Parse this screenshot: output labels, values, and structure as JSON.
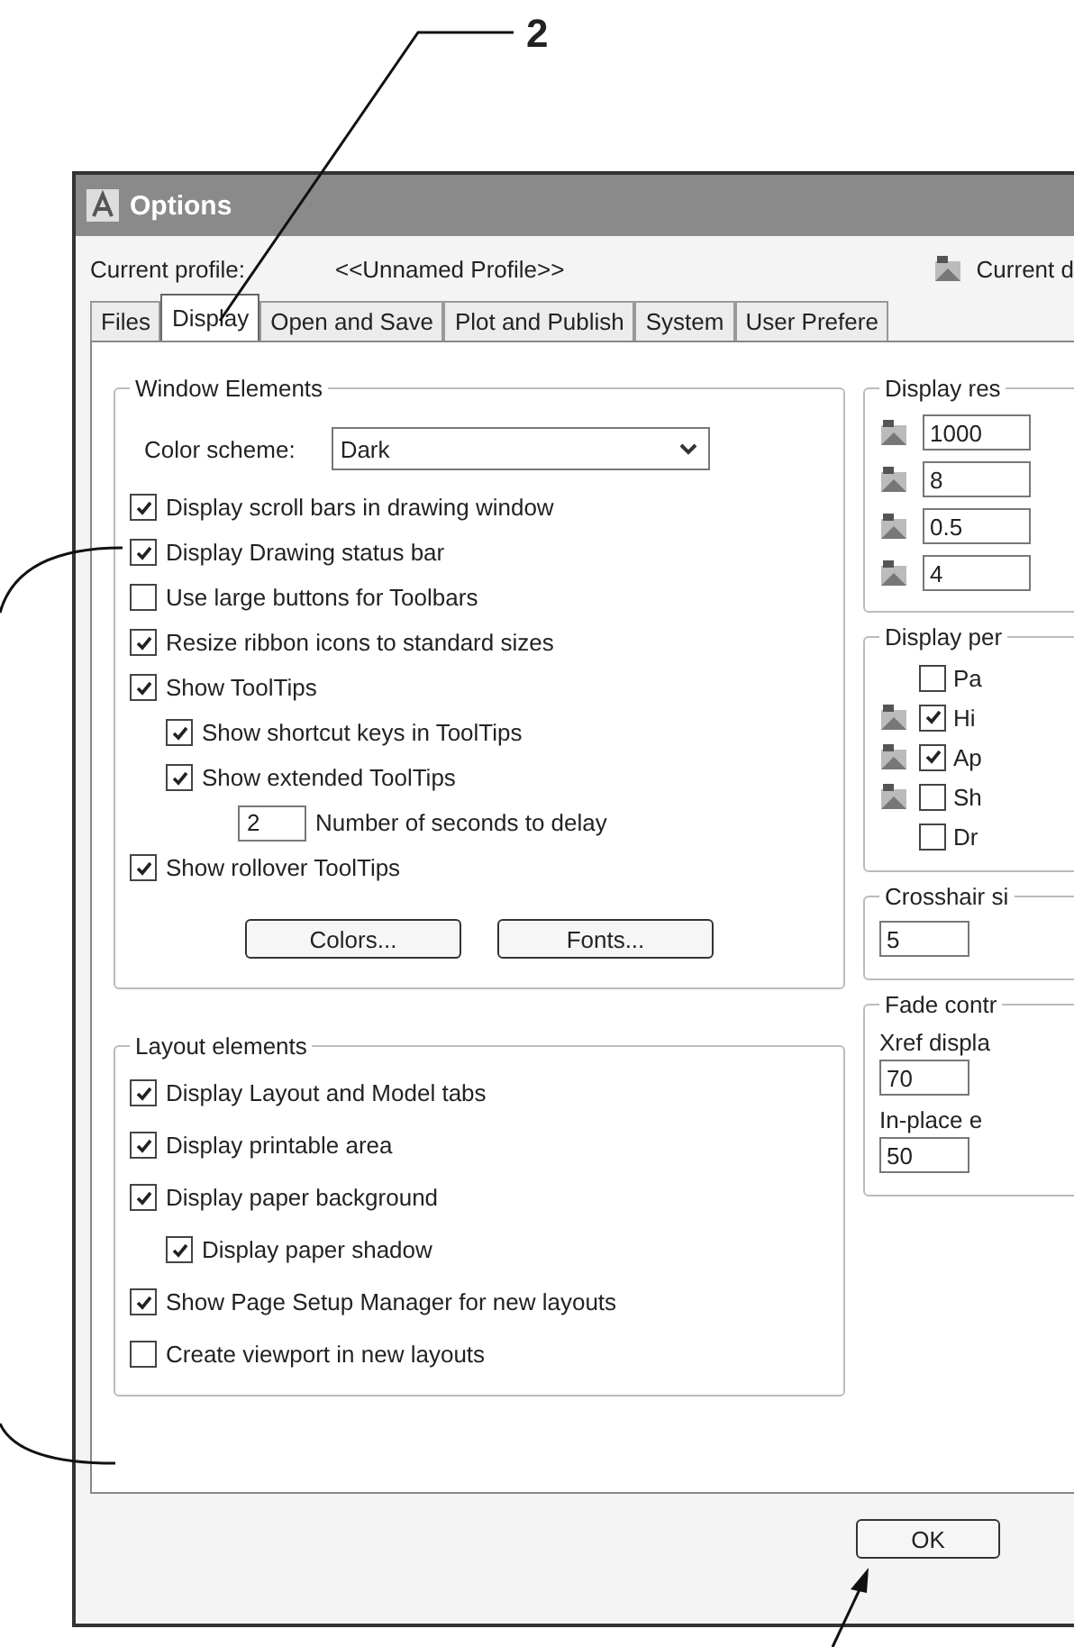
{
  "callout": {
    "label": "2"
  },
  "window": {
    "title": "Options"
  },
  "profile": {
    "label": "Current profile:",
    "value": "<<Unnamed Profile>>",
    "current": "Current d"
  },
  "tabs": [
    {
      "label": "Files",
      "selected": false
    },
    {
      "label": "Display",
      "selected": true
    },
    {
      "label": "Open and Save",
      "selected": false
    },
    {
      "label": "Plot and Publish",
      "selected": false
    },
    {
      "label": "System",
      "selected": false
    },
    {
      "label": "User Prefere",
      "selected": false
    }
  ],
  "window_elements": {
    "title": "Window Elements",
    "color_scheme": {
      "label": "Color scheme:",
      "value": "Dark"
    },
    "options": [
      {
        "kind": "checkbox",
        "label": "Display scroll bars in drawing window",
        "checked": true
      },
      {
        "kind": "checkbox",
        "label": "Display Drawing status bar",
        "checked": true
      },
      {
        "kind": "checkbox",
        "label": "Use large buttons for Toolbars",
        "checked": false
      },
      {
        "kind": "checkbox",
        "label": "Resize ribbon icons to standard sizes",
        "checked": true
      },
      {
        "kind": "checkbox",
        "label": "Show ToolTips",
        "checked": true,
        "children": [
          {
            "kind": "checkbox",
            "label": "Show shortcut keys in ToolTips",
            "checked": true
          },
          {
            "kind": "checkbox",
            "label": "Show extended ToolTips",
            "checked": true,
            "children": [
              {
                "kind": "number",
                "value": "2",
                "label": "Number of seconds to delay"
              }
            ]
          }
        ]
      },
      {
        "kind": "checkbox",
        "label": "Show rollover ToolTips",
        "checked": true
      }
    ],
    "buttons": [
      "Colors...",
      "Fonts..."
    ]
  },
  "layout_elements": {
    "title": "Layout elements",
    "options": [
      {
        "kind": "checkbox",
        "label": "Display Layout and Model tabs",
        "checked": true
      },
      {
        "kind": "checkbox",
        "label": "Display printable area",
        "checked": true
      },
      {
        "kind": "checkbox",
        "label": "Display paper background",
        "checked": true,
        "children": [
          {
            "kind": "checkbox",
            "label": "Display paper shadow",
            "checked": true
          }
        ]
      },
      {
        "kind": "checkbox",
        "label": "Show Page Setup Manager for new layouts",
        "checked": true
      },
      {
        "kind": "checkbox",
        "label": "Create viewport in new layouts",
        "checked": false
      }
    ]
  },
  "display_resolution": {
    "title": "Display res",
    "values": [
      "1000",
      "8",
      "0.5",
      "4"
    ]
  },
  "display_performance": {
    "title": "Display per",
    "options": [
      {
        "label": "Pa",
        "checked": false,
        "icon": false
      },
      {
        "label": "Hi",
        "checked": true,
        "icon": true
      },
      {
        "label": "Ap",
        "checked": true,
        "icon": true
      },
      {
        "label": "Sh",
        "checked": false,
        "icon": true
      },
      {
        "label": "Dr",
        "checked": false,
        "icon": false
      }
    ]
  },
  "crosshair": {
    "title": "Crosshair si",
    "value": "5"
  },
  "fade_control": {
    "title": "Fade contr",
    "xref_label": "Xref displa",
    "xref_value": "70",
    "inplace_label": "In-place e",
    "inplace_value": "50"
  },
  "footer_buttons": [
    "OK"
  ]
}
